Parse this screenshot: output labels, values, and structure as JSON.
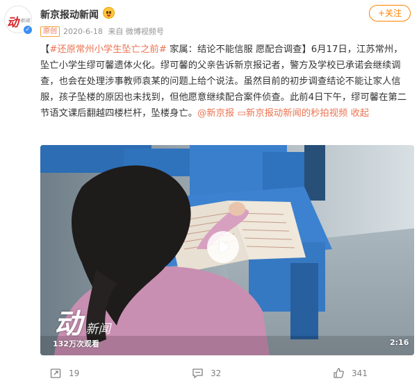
{
  "author": {
    "name": "新京报动新闻",
    "verified": true,
    "avatar_logo_text": "动"
  },
  "post_meta": {
    "original_badge": "原创",
    "date": "2020-6-18",
    "source": "来自 微博视频号"
  },
  "follow_button": "+关注",
  "content": {
    "hashtag": "#还原常州小学生坠亡之前#",
    "text_part1": " 家属：结论不能信服 愿配合调查】6月17日，江苏常州，坠亡小学生缪可馨遗体火化。缪可馨的父亲告诉新京报记者，警方及学校已承诺会继续调查，也会在处理涉事教师袁某的问题上给个说法。虽然目前的初步调查结论不能让家人信服，孩子坠楼的原因也未找到，但他愿意继续配合案件侦查。此前4日下午，缪可馨在第二节语文课后翻越四楼栏杆，坠楼身亡。",
    "bracket_open": "【",
    "mention": "@新京报",
    "video_link": "新京报动新闻的秒拍视频",
    "collapse": "收起"
  },
  "video": {
    "views": "132万次观看",
    "duration": "2:16",
    "watermark_text": "动"
  },
  "footer": {
    "reposts": "19",
    "comments": "32",
    "likes": "341"
  },
  "colors": {
    "accent": "#ff8200",
    "link": "#eb7350",
    "verified": "#3d8ff3"
  }
}
